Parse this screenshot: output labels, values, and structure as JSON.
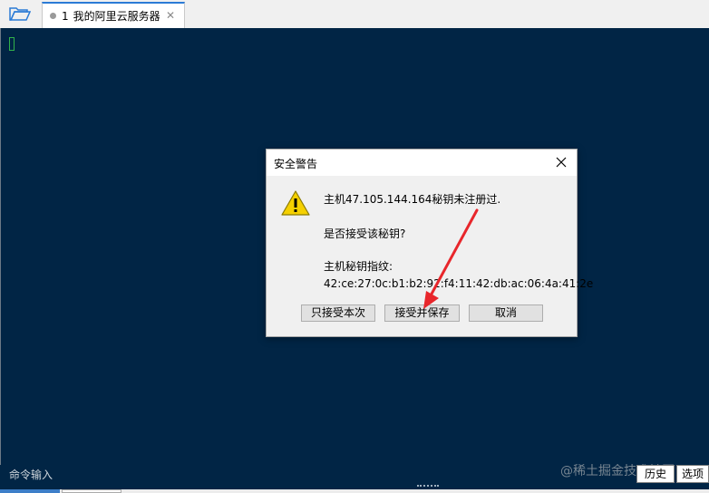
{
  "tabs": [
    {
      "number": "1",
      "label": "我的阿里云服务器"
    }
  ],
  "command_bar": {
    "label": "命令输入",
    "history_button": "历史",
    "options_button": "选项"
  },
  "watermark": "@稀土掘金技术社区",
  "dialog": {
    "title": "安全警告",
    "line1": "主机47.105.144.164秘钥未注册过.",
    "line2": "是否接受该秘钥?",
    "fingerprint_label": "主机秘钥指纹:",
    "fingerprint_value": "42:ce:27:0c:b1:b2:92:f4:11:42:db:ac:06:4a:41:2e",
    "buttons": {
      "accept_once": "只接受本次",
      "accept_save": "接受并保存",
      "cancel": "取消"
    }
  },
  "colors": {
    "terminal_bg": "#012545",
    "cursor": "#31b24b",
    "annotation_arrow": "#e8262b",
    "tab_accent": "#2b7bd6"
  }
}
